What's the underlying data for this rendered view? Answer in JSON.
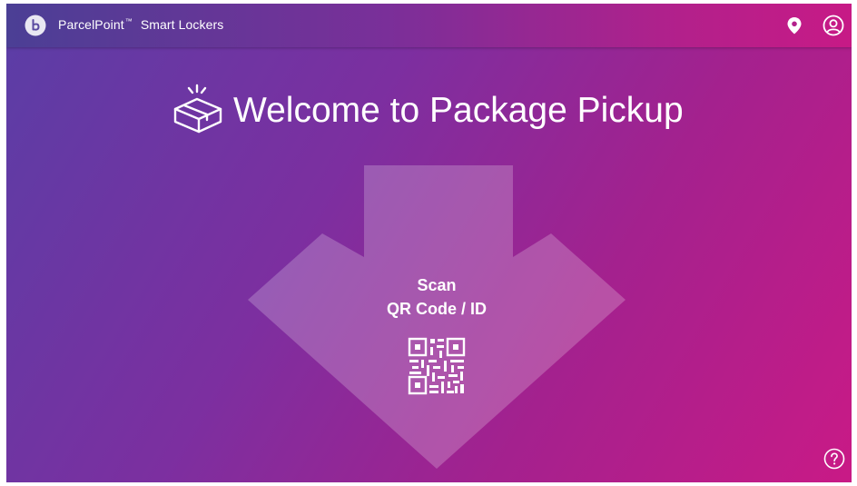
{
  "header": {
    "brand_name": "ParcelPoint",
    "trademark": "™",
    "product_name": "Smart Lockers",
    "logo_icon": "parcelpoint-logo-icon",
    "location_icon": "location-pin-icon",
    "user_icon": "user-account-icon"
  },
  "main": {
    "title": "Welcome to Package Pickup",
    "title_icon": "package-box-icon",
    "scan_prompt_line1": "Scan",
    "scan_prompt_line2": "QR Code / ID",
    "qr_icon": "qr-code-icon",
    "arrow_icon": "down-arrow-icon"
  },
  "footer": {
    "help_icon": "help-question-icon"
  },
  "colors": {
    "gradient_start": "#5a3ea6",
    "gradient_mid": "#7c2fa0",
    "gradient_end": "#c91a86",
    "text": "#ffffff"
  }
}
